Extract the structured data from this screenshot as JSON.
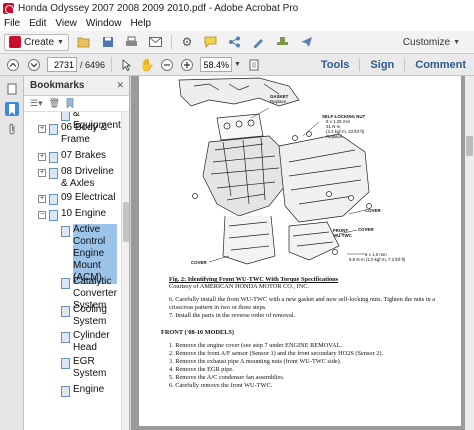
{
  "window": {
    "title": "Honda Odyssey 2007 2008 2009 2010.pdf - Adobe Acrobat Pro"
  },
  "menu": [
    "File",
    "Edit",
    "View",
    "Window",
    "Help"
  ],
  "toolbar": {
    "create_label": "Create",
    "customize_label": "Customize",
    "icons": [
      "open-folder-icon",
      "save-icon",
      "print-icon",
      "email-icon",
      "gear-icon",
      "comment-bubble-icon",
      "share-icon",
      "sign-pen-icon",
      "stamp-icon",
      "send-icon"
    ]
  },
  "nav": {
    "page_value": "2731",
    "page_total": "/ 6496",
    "zoom_value": "58.4%",
    "tools_label": "Tools",
    "sign_label": "Sign",
    "comment_label": "Comment"
  },
  "bookmarks": {
    "title": "Bookmarks",
    "items": [
      {
        "label": "& Equipment",
        "toggle": "",
        "level": 2
      },
      {
        "label": "06 Body & Frame",
        "toggle": "+",
        "level": 1
      },
      {
        "label": "07 Brakes",
        "toggle": "+",
        "level": 1
      },
      {
        "label": "08 Driveline & Axles",
        "toggle": "+",
        "level": 1
      },
      {
        "label": "09 Electrical",
        "toggle": "+",
        "level": 1
      },
      {
        "label": "10 Engine",
        "toggle": "−",
        "level": 1
      },
      {
        "label": "Active Control Engine Mount (ACM)",
        "toggle": "",
        "level": 2,
        "selected": true
      },
      {
        "label": "Catalytic Converter System",
        "toggle": "",
        "level": 2
      },
      {
        "label": "Cooling System",
        "toggle": "",
        "level": 2
      },
      {
        "label": "Cylinder Head",
        "toggle": "",
        "level": 2
      },
      {
        "label": "EGR System",
        "toggle": "",
        "level": 2
      },
      {
        "label": "Engine",
        "toggle": "",
        "level": 2
      }
    ]
  },
  "document": {
    "callouts": {
      "gasket": "GASKET",
      "gasket_sub": "Replace.",
      "nut": "SELF-LOCKING NUT",
      "nut_spec1": "8 x 1.25 mm",
      "nut_spec2": "31 N·m",
      "nut_spec3": "(3.2 kgf·m, 23 lbf·ft)",
      "nut_sub": "Replace.",
      "cover1": "COVER",
      "front_wu": "FRONT",
      "front_wu2": "WU-TWC",
      "cover2": "COVER",
      "bolt1": "6 x 1.0 mm",
      "bolt2": "9.8 N·m (1.0 kgf·m, 7.2 lbf·ft)",
      "cover3": "COVER"
    },
    "caption": "Fig. 2: Identifying Front WU-TWC With Torque Specifications",
    "courtesy": "Courtesy of AMERICAN HONDA MOTOR CO., INC.",
    "steps_a": [
      "6.   Carefully install the front WU-TWC with a new gasket and new self-locking nuts. Tighten the nuts in a crisscross pattern in two or three steps.",
      "7.   Install the parts in the reverse order of removal."
    ],
    "section": "FRONT ('08-10 MODELS)",
    "steps_b": [
      "1.   Remove the engine cover (see step 7 under ENGINE REMOVAL.",
      "2.   Remove the front A/F sensor (Sensor 1) and the front secondary HO2S (Sensor 2).",
      "3.   Remove the exhaust pipe A mounting nuts (front WU-TWC side).",
      "4.   Remove the EGR pipe.",
      "5.   Remove the A/C condenser fan assemblies.",
      "6.   Carefully remove the front WU-TWC."
    ]
  }
}
